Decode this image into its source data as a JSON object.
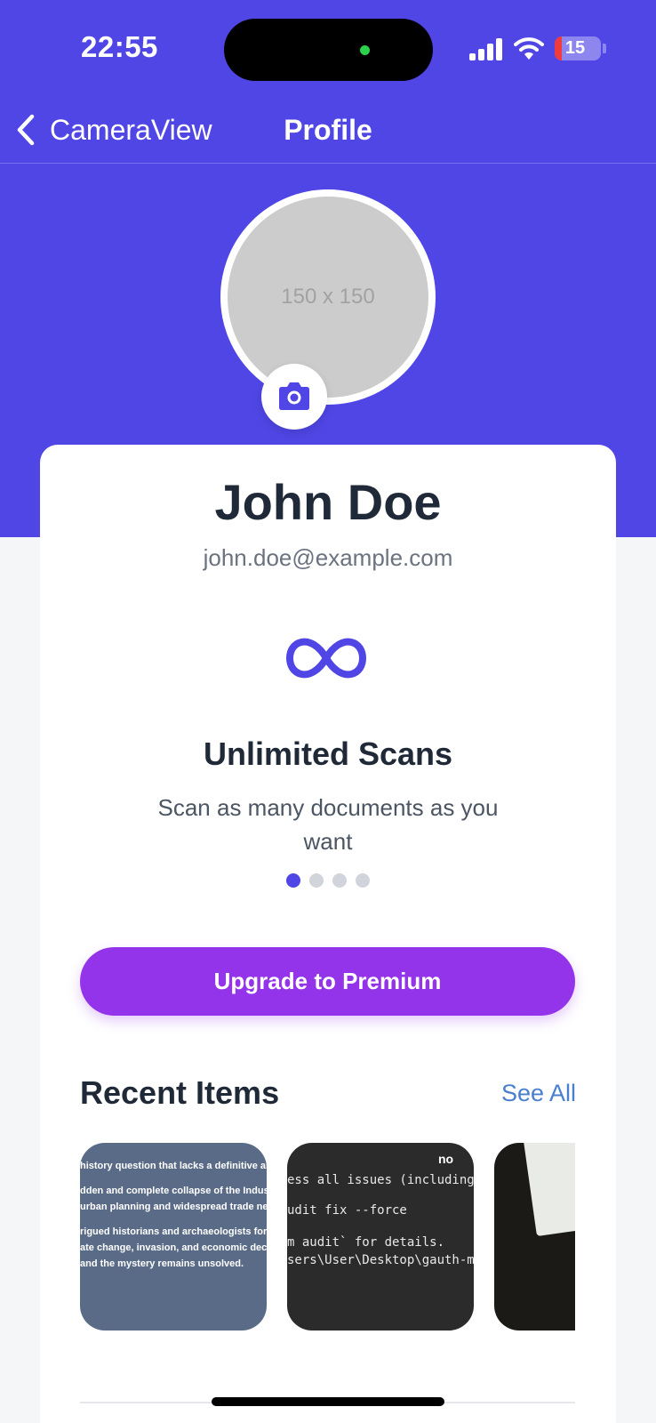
{
  "status_bar": {
    "time": "22:55",
    "battery": "15",
    "battery_level": 0.15
  },
  "nav": {
    "back_label": "CameraView",
    "title": "Profile"
  },
  "profile": {
    "avatar_placeholder": "150 x 150",
    "name": "John Doe",
    "email": "john.doe@example.com"
  },
  "feature": {
    "icon": "infinity-icon",
    "title": "Unlimited Scans",
    "description": "Scan as many documents as you want",
    "slide_count": 4,
    "active_slide": 1
  },
  "upgrade": {
    "label": "Upgrade to Premium"
  },
  "recent": {
    "title": "Recent Items",
    "see_all": "See All",
    "items": [
      {
        "lines": [
          "history question that lacks a definitive answer:",
          "dden and complete collapse of the Indus Valley C",
          "urban planning and widespread trade networks",
          "rigued historians and archaeologists for decades.",
          "ate change, invasion, and economic decline, no s",
          "and the mystery remains unsolved."
        ]
      },
      {
        "corner": "no",
        "lines": [
          "ess all issues (including br",
          "udit fix --force",
          "m audit` for details.",
          "sers\\User\\Desktop\\gauth-mobil"
        ]
      },
      {
        "lines": []
      }
    ]
  },
  "colors": {
    "primary": "#4f46e5",
    "upgrade": "#9333ea",
    "link": "#4a7fd0",
    "heading": "#1f2937"
  }
}
